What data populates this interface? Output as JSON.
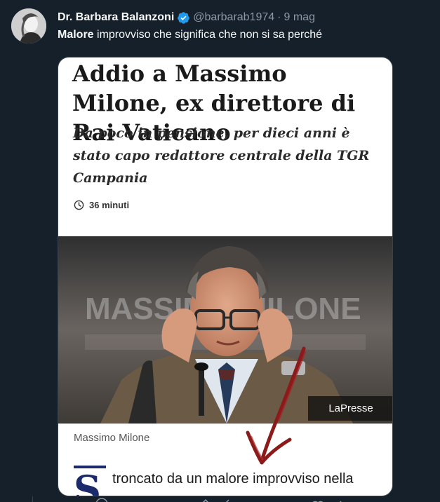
{
  "tweet": {
    "display_name": "Dr. Barbara Balanzoni",
    "verified_icon": "verified-badge-icon",
    "handle": "@barbarab1974",
    "separator": "·",
    "date": "9 mag",
    "text_bold": "Malore",
    "text_rest": " improvviso che significa che non si sa perché"
  },
  "article": {
    "headline": "Addio a Massimo Milone, ex direttore di Rai Vaticano",
    "subhead": "Da poco in pensione, per dieci anni è stato capo redattore centrale della TGR Campania",
    "read_time": "36 minuti",
    "photo_credit": "LaPresse",
    "caption": "Massimo Milone",
    "dropcap": "S",
    "body_start": "troncato da un malore improvviso nella"
  },
  "colors": {
    "background": "#15202b",
    "verified": "#1d9bf0",
    "dropcap": "#1b2a6b",
    "arrow": "#8b1a1a"
  }
}
